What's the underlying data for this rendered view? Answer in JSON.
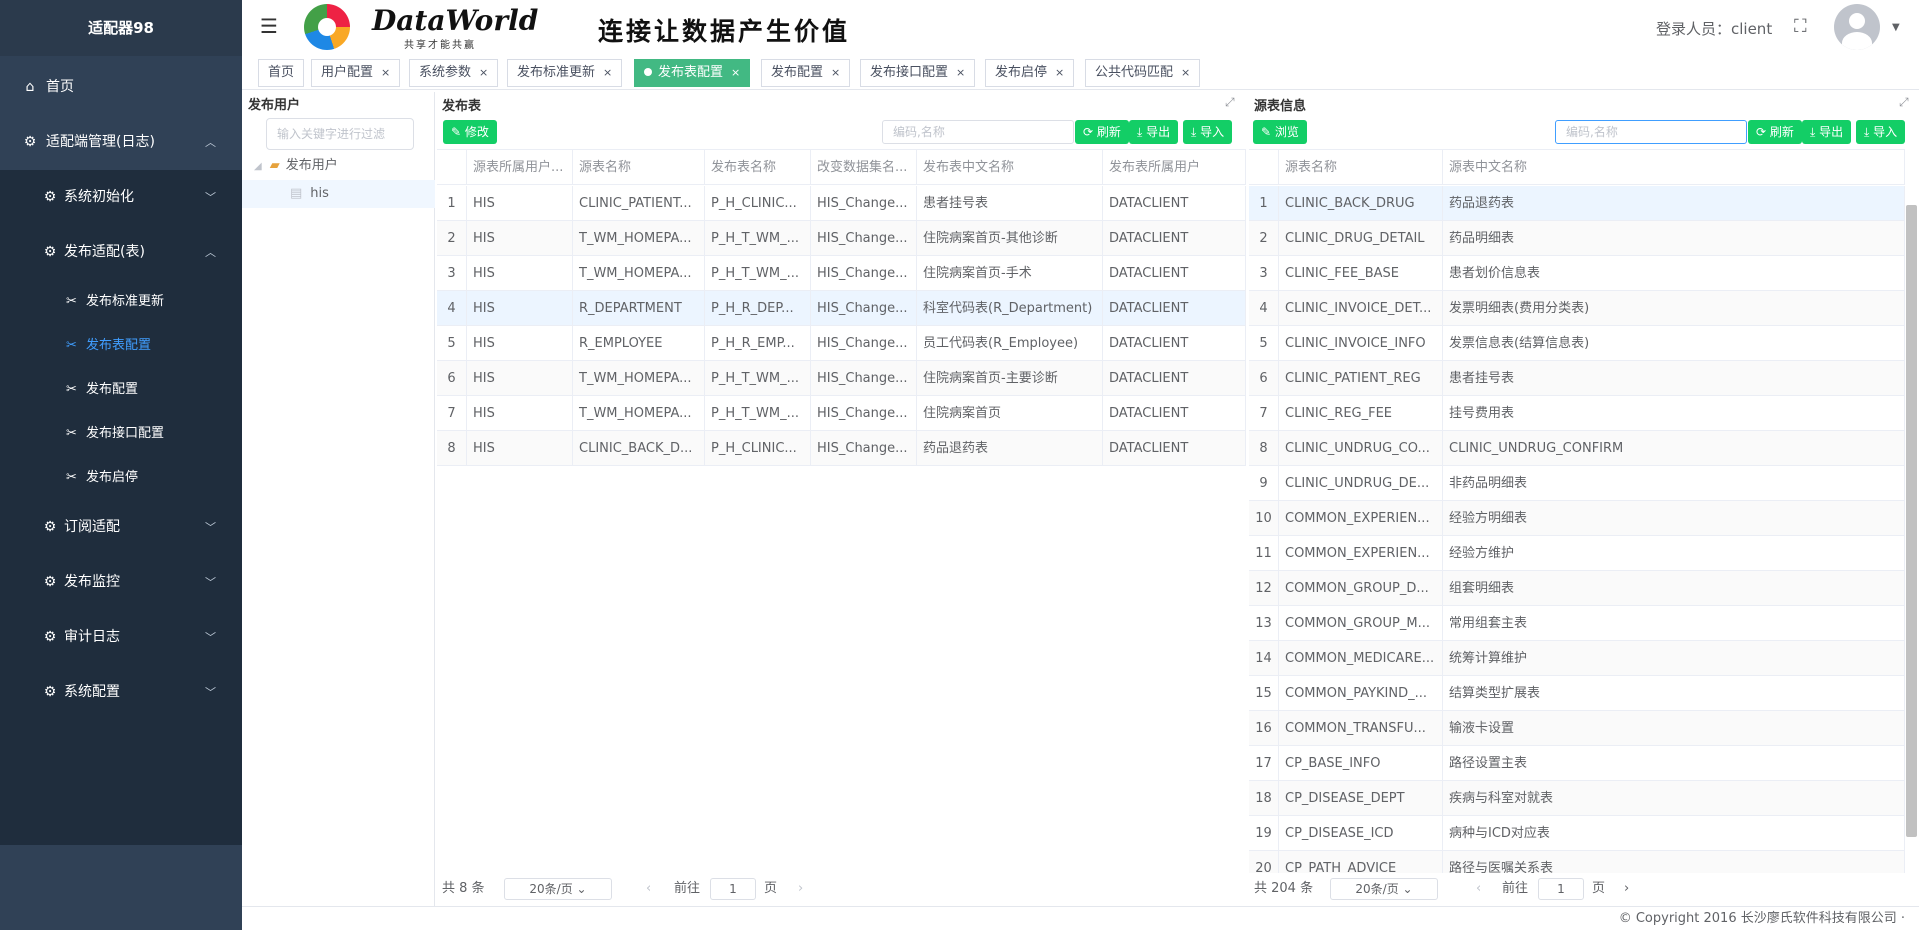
{
  "app": {
    "title": "适配器98"
  },
  "sidebar": {
    "home": "首页",
    "adapter_mgmt": "适配端管理(日志)",
    "sys_init": "系统初始化",
    "publish_adapt": "发布适配(表)",
    "leaves": [
      "发布标准更新",
      "发布表配置",
      "发布配置",
      "发布接口配置",
      "发布启停"
    ],
    "subscribe": "订阅适配",
    "publish_monitor": "发布监控",
    "audit_log": "审计日志",
    "sys_config": "系统配置"
  },
  "header": {
    "brand": "DataWorld",
    "brand_sub": "共享才能共赢",
    "slogan": "连接让数据产生价值",
    "login": "登录人员：client"
  },
  "tabs": [
    "首页",
    "用户配置",
    "系统参数",
    "发布标准更新",
    "发布表配置",
    "发布配置",
    "发布接口配置",
    "发布启停",
    "公共代码匹配"
  ],
  "tree": {
    "title": "发布用户",
    "filter_placeholder": "输入关键字进行过滤",
    "root": "发布用户",
    "child": "his"
  },
  "publish": {
    "title": "发布表",
    "edit": "修改",
    "search_placeholder": "编码,名称",
    "refresh": "刷新",
    "export": "导出",
    "import": "导入",
    "columns": [
      "源表所属用户...",
      "源表名称",
      "发布表名称",
      "改变数据集名...",
      "发布表中文名称",
      "发布表所属用户"
    ],
    "rows": [
      [
        "1",
        "HIS",
        "CLINIC_PATIENT...",
        "P_H_CLINIC...",
        "HIS_Change...",
        "患者挂号表",
        "DATACLIENT"
      ],
      [
        "2",
        "HIS",
        "T_WM_HOMEPA...",
        "P_H_T_WM_...",
        "HIS_Change...",
        "住院病案首页-其他诊断",
        "DATACLIENT"
      ],
      [
        "3",
        "HIS",
        "T_WM_HOMEPA...",
        "P_H_T_WM_...",
        "HIS_Change...",
        "住院病案首页-手术",
        "DATACLIENT"
      ],
      [
        "4",
        "HIS",
        "R_DEPARTMENT",
        "P_H_R_DEP...",
        "HIS_Change...",
        "科室代码表(R_Department)",
        "DATACLIENT"
      ],
      [
        "5",
        "HIS",
        "R_EMPLOYEE",
        "P_H_R_EMP...",
        "HIS_Change...",
        "员工代码表(R_Employee)",
        "DATACLIENT"
      ],
      [
        "6",
        "HIS",
        "T_WM_HOMEPA...",
        "P_H_T_WM_...",
        "HIS_Change...",
        "住院病案首页-主要诊断",
        "DATACLIENT"
      ],
      [
        "7",
        "HIS",
        "T_WM_HOMEPA...",
        "P_H_T_WM_...",
        "HIS_Change...",
        "住院病案首页",
        "DATACLIENT"
      ],
      [
        "8",
        "HIS",
        "CLINIC_BACK_D...",
        "P_H_CLINIC...",
        "HIS_Change...",
        "药品退药表",
        "DATACLIENT"
      ]
    ],
    "total": "共 8 条",
    "page_size": "20条/页",
    "goto": "前往",
    "page": "1",
    "page_unit": "页"
  },
  "source": {
    "title": "源表信息",
    "browse": "浏览",
    "search_placeholder": "编码,名称",
    "refresh": "刷新",
    "export": "导出",
    "import": "导入",
    "columns": [
      "源表名称",
      "源表中文名称"
    ],
    "rows": [
      [
        "1",
        "CLINIC_BACK_DRUG",
        "药品退药表"
      ],
      [
        "2",
        "CLINIC_DRUG_DETAIL",
        "药品明细表"
      ],
      [
        "3",
        "CLINIC_FEE_BASE",
        "患者划价信息表"
      ],
      [
        "4",
        "CLINIC_INVOICE_DET...",
        "发票明细表(费用分类表)"
      ],
      [
        "5",
        "CLINIC_INVOICE_INFO",
        "发票信息表(结算信息表)"
      ],
      [
        "6",
        "CLINIC_PATIENT_REG",
        "患者挂号表"
      ],
      [
        "7",
        "CLINIC_REG_FEE",
        "挂号费用表"
      ],
      [
        "8",
        "CLINIC_UNDRUG_CO...",
        "CLINIC_UNDRUG_CONFIRM"
      ],
      [
        "9",
        "CLINIC_UNDRUG_DE...",
        "非药品明细表"
      ],
      [
        "10",
        "COMMON_EXPERIEN...",
        "经验方明细表"
      ],
      [
        "11",
        "COMMON_EXPERIEN...",
        "经验方维护"
      ],
      [
        "12",
        "COMMON_GROUP_D...",
        "组套明细表"
      ],
      [
        "13",
        "COMMON_GROUP_M...",
        "常用组套主表"
      ],
      [
        "14",
        "COMMON_MEDICARE...",
        "统筹计算维护"
      ],
      [
        "15",
        "COMMON_PAYKIND_...",
        "结算类型扩展表"
      ],
      [
        "16",
        "COMMON_TRANSFU...",
        "输液卡设置"
      ],
      [
        "17",
        "CP_BASE_INFO",
        "路径设置主表"
      ],
      [
        "18",
        "CP_DISEASE_DEPT",
        "疾病与科室对就表"
      ],
      [
        "19",
        "CP_DISEASE_ICD",
        "病种与ICD对应表"
      ],
      [
        "20",
        "CP_PATH_ADVICE",
        "路径与医嘱关系表"
      ]
    ],
    "total": "共 204 条",
    "page_size": "20条/页",
    "goto": "前往",
    "page": "1",
    "page_unit": "页"
  },
  "footer": "© Copyright 2016 长沙廖氏软件科技有限公司 ·"
}
